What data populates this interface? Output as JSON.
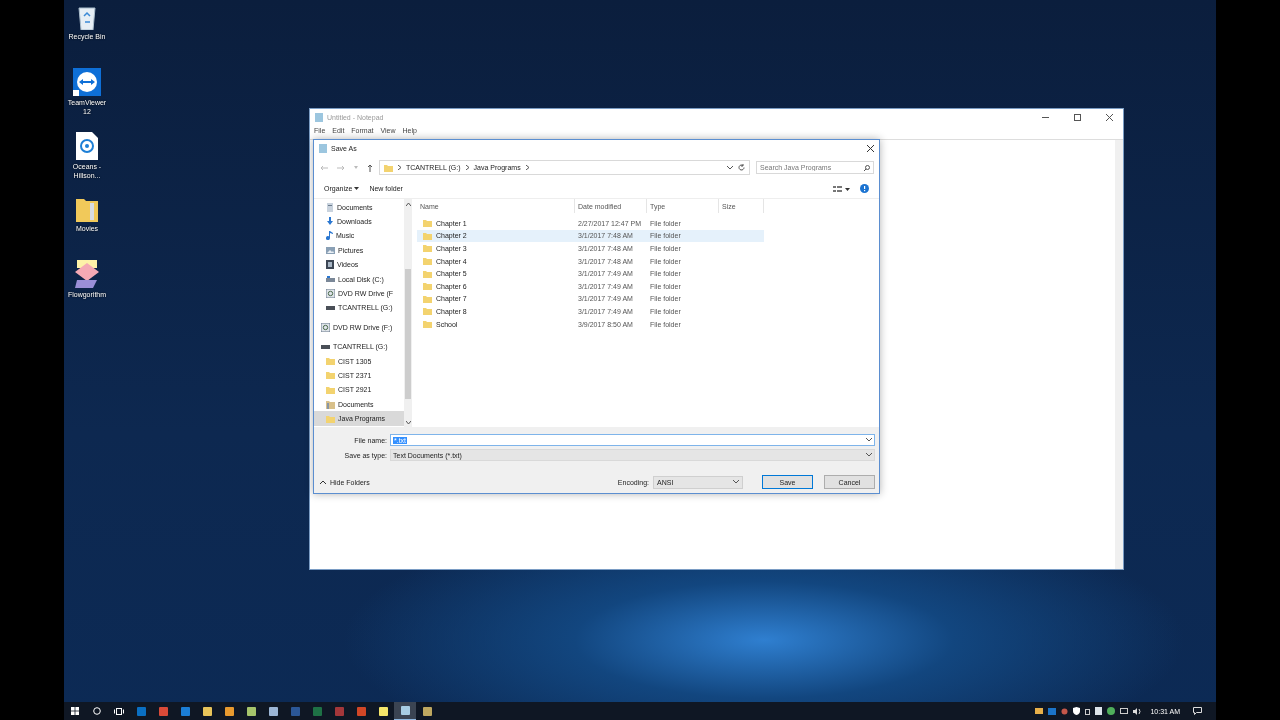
{
  "desktop_icons": [
    {
      "label": "Recycle Bin",
      "kind": "recycle"
    },
    {
      "label": "TeamViewer 12",
      "kind": "teamviewer"
    },
    {
      "label": "Oceans - Hillson...",
      "kind": "audio"
    },
    {
      "label": "Movies",
      "kind": "folder"
    },
    {
      "label": "Flowgorithm",
      "kind": "flowchart"
    }
  ],
  "notepad": {
    "title": "Untitled - Notepad",
    "menu": [
      "File",
      "Edit",
      "Format",
      "View",
      "Help"
    ]
  },
  "save_dialog": {
    "title": "Save As",
    "breadcrumb": [
      "TCANTRELL (G:)",
      "Java Programs"
    ],
    "search": {
      "placeholder": "Search Java Programs"
    },
    "organize": "Organize",
    "new_folder": "New folder",
    "nav_quick": [
      {
        "label": "Documents",
        "kind": "documents",
        "selected": false
      },
      {
        "label": "Downloads",
        "kind": "downloads",
        "selected": false
      },
      {
        "label": "Music",
        "kind": "music",
        "selected": false
      },
      {
        "label": "Pictures",
        "kind": "pictures",
        "selected": false
      },
      {
        "label": "Videos",
        "kind": "videos",
        "selected": false
      },
      {
        "label": "Local Disk (C:)",
        "kind": "disk",
        "selected": false
      },
      {
        "label": "DVD RW Drive (F",
        "kind": "dvd",
        "selected": false
      },
      {
        "label": "TCANTRELL (G:)",
        "kind": "drive",
        "selected": false
      }
    ],
    "nav_tree": [
      {
        "label": "DVD RW Drive (F:)",
        "kind": "dvd",
        "selected": false
      },
      {
        "label": "TCANTRELL (G:)",
        "kind": "drive",
        "selected": false,
        "children": [
          {
            "label": "CIST 1305",
            "kind": "folder",
            "selected": false
          },
          {
            "label": "CIST 2371",
            "kind": "folder",
            "selected": false
          },
          {
            "label": "CIST 2921",
            "kind": "folder",
            "selected": false
          },
          {
            "label": "Documents",
            "kind": "libfolder",
            "selected": false
          },
          {
            "label": "Java Programs",
            "kind": "folder",
            "selected": true
          }
        ]
      }
    ],
    "columns": [
      "Name",
      "Date modified",
      "Type",
      "Size"
    ],
    "rows": [
      {
        "name": "Chapter 1",
        "date": "2/27/2017 12:47 PM",
        "type": "File folder",
        "selected": false
      },
      {
        "name": "Chapter 2",
        "date": "3/1/2017 7:48 AM",
        "type": "File folder",
        "selected": true
      },
      {
        "name": "Chapter 3",
        "date": "3/1/2017 7:48 AM",
        "type": "File folder",
        "selected": false
      },
      {
        "name": "Chapter 4",
        "date": "3/1/2017 7:48 AM",
        "type": "File folder",
        "selected": false
      },
      {
        "name": "Chapter 5",
        "date": "3/1/2017 7:49 AM",
        "type": "File folder",
        "selected": false
      },
      {
        "name": "Chapter 6",
        "date": "3/1/2017 7:49 AM",
        "type": "File folder",
        "selected": false
      },
      {
        "name": "Chapter 7",
        "date": "3/1/2017 7:49 AM",
        "type": "File folder",
        "selected": false
      },
      {
        "name": "Chapter 8",
        "date": "3/1/2017 7:49 AM",
        "type": "File folder",
        "selected": false
      },
      {
        "name": "School",
        "date": "3/9/2017 8:50 AM",
        "type": "File folder",
        "selected": false
      }
    ],
    "file_name_label": "File name:",
    "file_name": "*.txt",
    "save_type_label": "Save as type:",
    "save_type": "Text Documents (*.txt)",
    "hide_folders": "Hide Folders",
    "encoding_label": "Encoding:",
    "encoding": "ANSI",
    "save": "Save",
    "cancel": "Cancel"
  },
  "taskbar": {
    "apps": [
      {
        "kind": "outlook",
        "active": false
      },
      {
        "kind": "chrome",
        "active": false
      },
      {
        "kind": "edge",
        "active": false
      },
      {
        "kind": "explorer",
        "active": false
      },
      {
        "kind": "media",
        "active": false
      },
      {
        "kind": "green",
        "active": false
      },
      {
        "kind": "cube",
        "active": false
      },
      {
        "kind": "word",
        "active": false
      },
      {
        "kind": "excel",
        "active": false
      },
      {
        "kind": "access",
        "active": false
      },
      {
        "kind": "powerpoint",
        "active": false
      },
      {
        "kind": "sticky",
        "active": false
      },
      {
        "kind": "notepad",
        "active": true
      },
      {
        "kind": "flow",
        "active": false
      }
    ],
    "clock": "10:31 AM"
  }
}
